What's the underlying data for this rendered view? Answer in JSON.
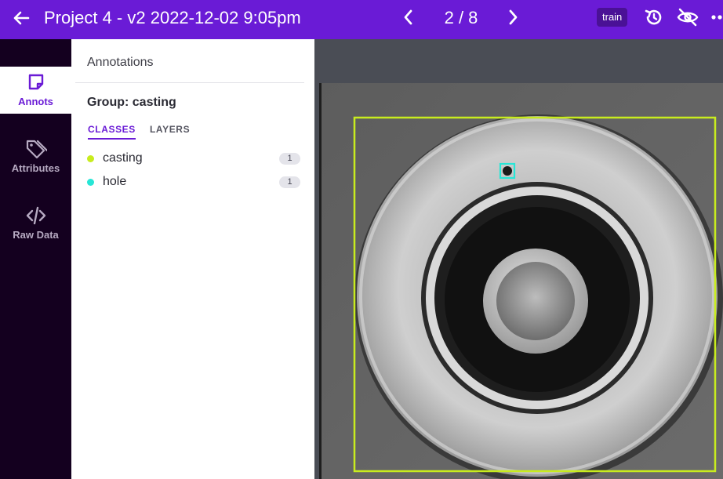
{
  "header": {
    "title": "Project 4 - v2 2022-12-02 9:05pm",
    "pager": "2 / 8",
    "split_badge": "train",
    "icons": {
      "back": "arrow-left-icon",
      "prev": "chevron-left-icon",
      "next": "chevron-right-icon",
      "history": "history-icon",
      "hide": "eye-off-icon",
      "more": "more-horizontal-icon"
    }
  },
  "sidebar": {
    "items": [
      {
        "label": "Annots",
        "icon": "sticky-note-icon",
        "active": true
      },
      {
        "label": "Attributes",
        "icon": "tag-icon",
        "active": false
      },
      {
        "label": "Raw Data",
        "icon": "code-icon",
        "active": false
      }
    ]
  },
  "panel": {
    "title": "Annotations",
    "group_title": "Group: casting",
    "tabs": [
      "CLASSES",
      "LAYERS"
    ],
    "active_tab": "CLASSES",
    "classes": [
      {
        "name": "casting",
        "count": "1",
        "color": "#c8ec1e"
      },
      {
        "name": "hole",
        "count": "1",
        "color": "#27e6d6"
      }
    ]
  },
  "canvas": {
    "image_subject": "metal casting disc with hole defect",
    "annotations": [
      {
        "class": "casting",
        "color": "#c8ec1e"
      },
      {
        "class": "hole",
        "color": "#27e6d6"
      }
    ],
    "colors": {
      "accent": "#6a1bd6",
      "rail_bg": "#14001f",
      "canvas_bg": "#4a4d55"
    }
  }
}
